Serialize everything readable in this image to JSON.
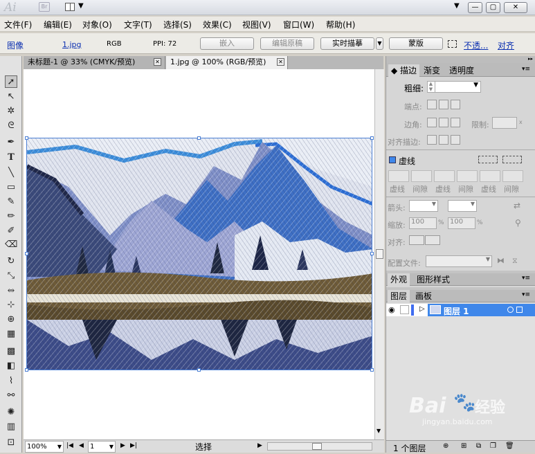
{
  "app": {
    "logo": "Ai",
    "bridge": "Br"
  },
  "menu": [
    "文件(F)",
    "编辑(E)",
    "对象(O)",
    "文字(T)",
    "选择(S)",
    "效果(C)",
    "视图(V)",
    "窗口(W)",
    "帮助(H)"
  ],
  "control": {
    "object_type": "图像",
    "filename": "1.jpg",
    "color_mode": "RGB",
    "ppi": "PPI: 72",
    "embed": "嵌入",
    "edit_original": "编辑原稿",
    "live_trace": "实时描摹",
    "mask": "蒙版",
    "opacity": "不透...",
    "align": "对齐"
  },
  "tabs": [
    {
      "label": "未标题-1 @ 33% (CMYK/预览)"
    },
    {
      "label": "1.jpg @ 100% (RGB/预览)"
    }
  ],
  "status": {
    "zoom": "100%",
    "page": "1",
    "tool": "选择"
  },
  "panel": {
    "tabs": [
      "描边",
      "渐变",
      "透明度"
    ],
    "weight_label": "粗细:",
    "cap_label": "端点:",
    "corner_label": "边角:",
    "limit_label": "限制:",
    "align_stroke_label": "对齐描边:",
    "dashed_label": "虚线",
    "dash_labels": [
      "虚线",
      "间隙",
      "虚线",
      "间隙",
      "虚线",
      "间隙"
    ],
    "arrow_label": "箭头:",
    "scale_label": "缩放:",
    "scale_value": "100",
    "percent": "%",
    "align_label": "对齐:",
    "profile_label": "配置文件:",
    "tabs2": [
      "外观",
      "图形样式"
    ],
    "tabs3": [
      "图层",
      "画板"
    ],
    "layer_name": "图层 1",
    "layer_count": "1 个图层"
  },
  "watermark": {
    "brand": "Bai",
    "brand2": "经验",
    "url": "jingyan.baidu.com"
  },
  "colors": {
    "accent": "#3f87ea",
    "link": "#0b2fb0"
  }
}
